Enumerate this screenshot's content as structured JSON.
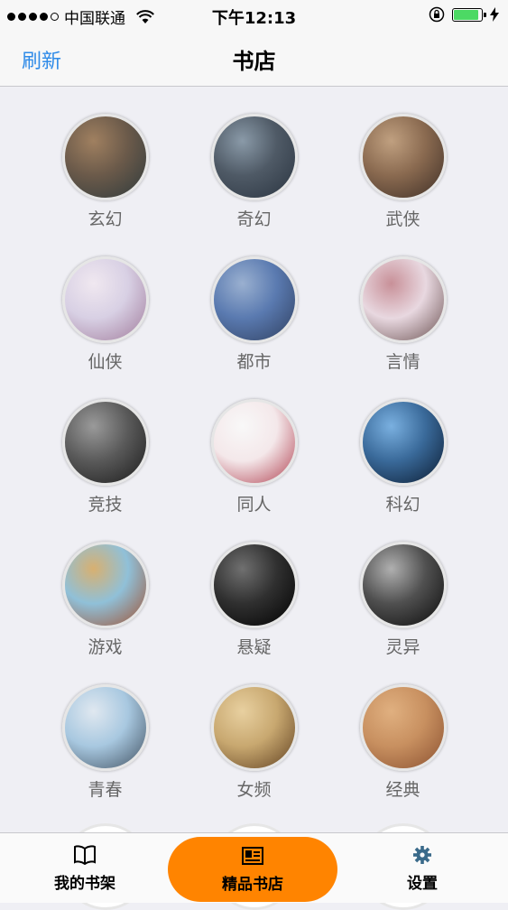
{
  "status": {
    "carrier": "中国联通",
    "time": "下午12:13",
    "battery_level": 0.9,
    "battery_color": "#4cd964"
  },
  "nav": {
    "refresh_label": "刷新",
    "title": "书店"
  },
  "categories": [
    {
      "label": "玄幻",
      "colors": [
        "#6b5a4a",
        "#2e3a3c",
        "#a08060"
      ]
    },
    {
      "label": "奇幻",
      "colors": [
        "#4f5a66",
        "#2a3440",
        "#8a9aa8"
      ]
    },
    {
      "label": "武侠",
      "colors": [
        "#8a6a50",
        "#3d2e26",
        "#c0a080"
      ]
    },
    {
      "label": "仙侠",
      "colors": [
        "#d8d0e4",
        "#a07a9a",
        "#f0e8f0"
      ]
    },
    {
      "label": "都市",
      "colors": [
        "#5a7ab0",
        "#2f3f5f",
        "#9ab0d0"
      ]
    },
    {
      "label": "言情",
      "colors": [
        "#e8d8e0",
        "#6a5050",
        "#c89098"
      ]
    },
    {
      "label": "竞技",
      "colors": [
        "#5a5a5a",
        "#1a1a1a",
        "#9a9a9a"
      ]
    },
    {
      "label": "同人",
      "colors": [
        "#f4e8ea",
        "#b04050",
        "#f8f8f8"
      ]
    },
    {
      "label": "科幻",
      "colors": [
        "#3a6a9a",
        "#0a1a30",
        "#7ab0e0"
      ]
    },
    {
      "label": "游戏",
      "colors": [
        "#90c0d8",
        "#a05030",
        "#d8b070"
      ]
    },
    {
      "label": "悬疑",
      "colors": [
        "#303030",
        "#000000",
        "#707070"
      ]
    },
    {
      "label": "灵异",
      "colors": [
        "#505050",
        "#0a0a0a",
        "#b0b0b0"
      ]
    },
    {
      "label": "青春",
      "colors": [
        "#a8c8e0",
        "#405060",
        "#e0e8f0"
      ]
    },
    {
      "label": "女频",
      "colors": [
        "#c8a870",
        "#604020",
        "#e8d0a0"
      ]
    },
    {
      "label": "经典",
      "colors": [
        "#c89060",
        "#8a5030",
        "#e0b080"
      ]
    }
  ],
  "tabs": {
    "bookshelf": "我的书架",
    "store": "精品书店",
    "settings": "设置",
    "active_color": "#ff8400"
  }
}
